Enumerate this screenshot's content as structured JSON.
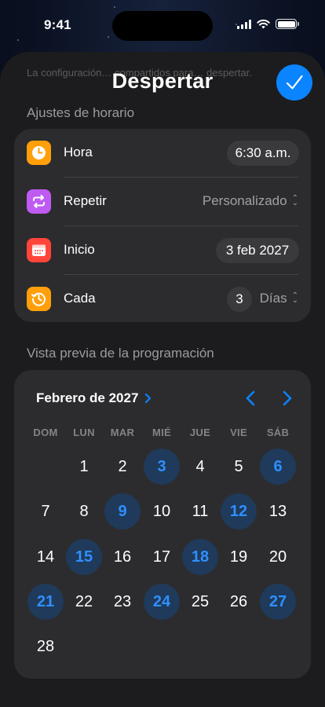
{
  "status_bar": {
    "time": "9:41"
  },
  "sheet": {
    "background_text": "La configuración… compartidos para… despertar.",
    "title": "Despertar",
    "done_icon": "checkmark-icon",
    "accent_color": "#0a84ff"
  },
  "schedule": {
    "section_label": "Ajustes de horario",
    "rows": [
      {
        "label": "Hora",
        "icon": "clock-icon",
        "icon_color": "#ff9f0a",
        "value": "6:30 a.m."
      },
      {
        "label": "Repetir",
        "icon": "repeat-icon",
        "icon_color": "#bf5af2",
        "value": "Personalizado"
      },
      {
        "label": "Inicio",
        "icon": "calendar-icon",
        "icon_color": "#ff453a",
        "value": "3 feb 2027"
      },
      {
        "label": "Cada",
        "icon": "history-icon",
        "icon_color": "#ff9f0a",
        "value": "3",
        "unit": "Días"
      }
    ]
  },
  "preview": {
    "section_label": "Vista previa de la programación",
    "month_title": "Febrero de 2027",
    "weekdays": [
      "DOM",
      "LUN",
      "MAR",
      "MIÉ",
      "JUE",
      "VIE",
      "SÁB"
    ],
    "first_weekday_index": 1,
    "days_in_month": 28,
    "marked_days": [
      3,
      6,
      9,
      12,
      15,
      18,
      21,
      24,
      27
    ],
    "marked_color": "#2f8fff"
  }
}
